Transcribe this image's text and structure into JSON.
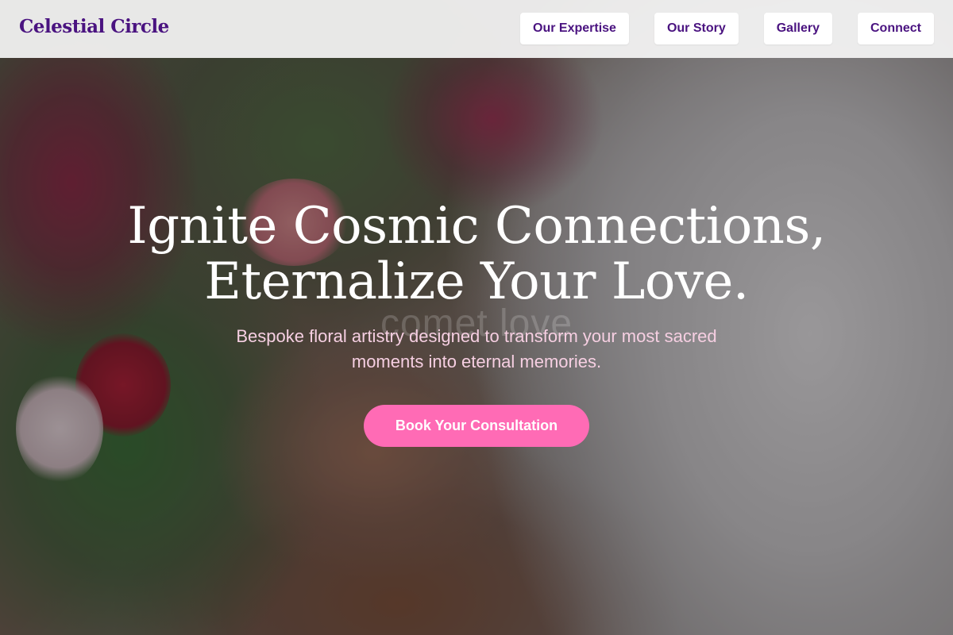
{
  "header": {
    "brand": "Celestial Circle",
    "nav": [
      {
        "label": "Our Expertise"
      },
      {
        "label": "Our Story"
      },
      {
        "label": "Gallery"
      },
      {
        "label": "Connect"
      }
    ]
  },
  "hero": {
    "title_line1": "Ignite Cosmic Connections,",
    "title_line2": "Eternalize Your Love.",
    "watermark": "comet love",
    "subtitle": "Bespoke floral artistry designed to transform your most sacred moments into eternal memories.",
    "cta_label": "Book Your Consultation"
  },
  "colors": {
    "brand": "#4a1380",
    "cta_background": "#ff6bb5",
    "subtitle_text": "#f6cfe2"
  }
}
